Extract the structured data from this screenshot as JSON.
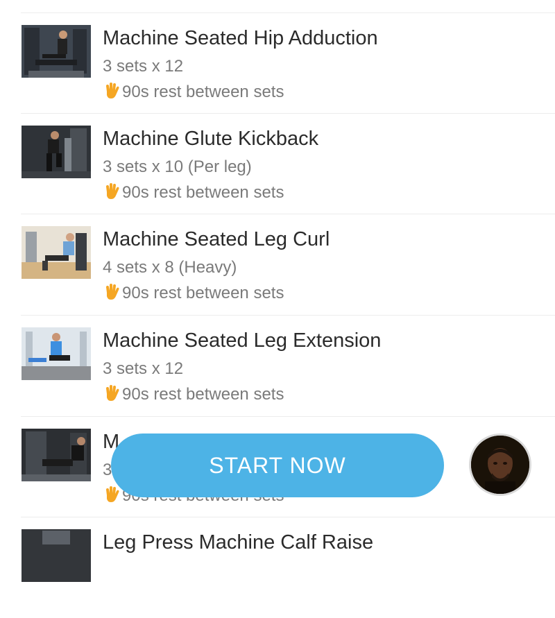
{
  "exercises": [
    {
      "title": "",
      "sets": "",
      "rest": ""
    },
    {
      "title": "Machine Seated Hip Adduction",
      "sets": "3 sets x 12",
      "rest": "90s rest between sets"
    },
    {
      "title": "Machine Glute Kickback",
      "sets": "3 sets x 10 (Per leg)",
      "rest": "90s rest between sets"
    },
    {
      "title": "Machine Seated Leg Curl",
      "sets": "4 sets x 8 (Heavy)",
      "rest": "90s rest between sets"
    },
    {
      "title": "Machine Seated Leg Extension",
      "sets": "3 sets x 12",
      "rest": "90s rest between sets"
    },
    {
      "title": "M",
      "sets": "3",
      "rest": "90s rest between sets"
    },
    {
      "title": "Leg Press Machine Calf Raise",
      "sets": "",
      "rest": ""
    }
  ],
  "cta": {
    "label": "START NOW",
    "color": "#4db3e6"
  },
  "icons": {
    "rest": "waving-hand-icon",
    "coach": "coach-avatar"
  }
}
